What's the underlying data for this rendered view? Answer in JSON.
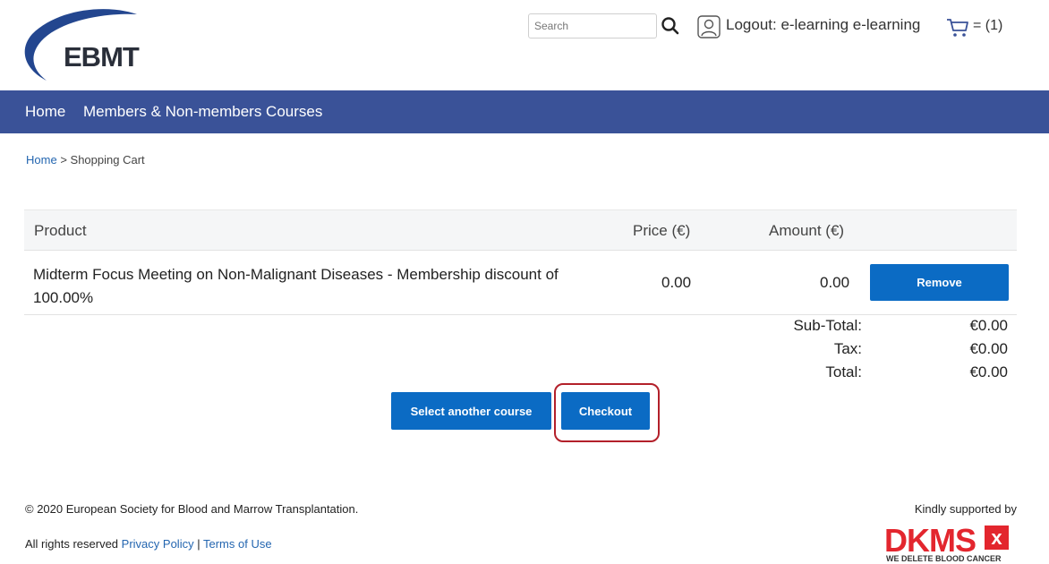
{
  "header": {
    "logo_text": "EBMT",
    "search_placeholder": "Search",
    "logout_label": "Logout: e-learning e-learning",
    "cart_count": "= (1)"
  },
  "nav": {
    "items": [
      {
        "label": "Home"
      },
      {
        "label": "Members & Non-members Courses"
      }
    ]
  },
  "breadcrumb": {
    "home": "Home",
    "separator": ">",
    "current": "Shopping Cart"
  },
  "cart": {
    "columns": {
      "product": "Product",
      "price": "Price (€)",
      "amount": "Amount (€)"
    },
    "rows": [
      {
        "product": "Midterm Focus Meeting on Non-Malignant Diseases - Membership discount of 100.00%",
        "price": "0.00",
        "amount": "0.00",
        "remove_label": "Remove"
      }
    ],
    "subtotal_label": "Sub-Total:",
    "subtotal_value": "€0.00",
    "tax_label": "Tax:",
    "tax_value": "€0.00",
    "total_label": "Total:",
    "total_value": "€0.00",
    "select_another_label": "Select another course",
    "checkout_label": "Checkout"
  },
  "footer": {
    "copyright": "© 2020 European Society for Blood and Marrow Transplantation.",
    "rights_prefix": "All rights reserved",
    "privacy_label": "Privacy Policy",
    "divider": "|",
    "terms_label": "Terms of Use",
    "supported_by": "Kindly supported by",
    "sponsor_logo_text": "DKMS",
    "sponsor_logo_mark": "x",
    "sponsor_tagline": "WE DELETE BLOOD CANCER"
  },
  "colors": {
    "nav_bg": "#3a5298",
    "button_bg": "#0b6bc4",
    "link": "#2466b0",
    "highlight": "#b3202a",
    "dkms_red": "#e3262e"
  }
}
